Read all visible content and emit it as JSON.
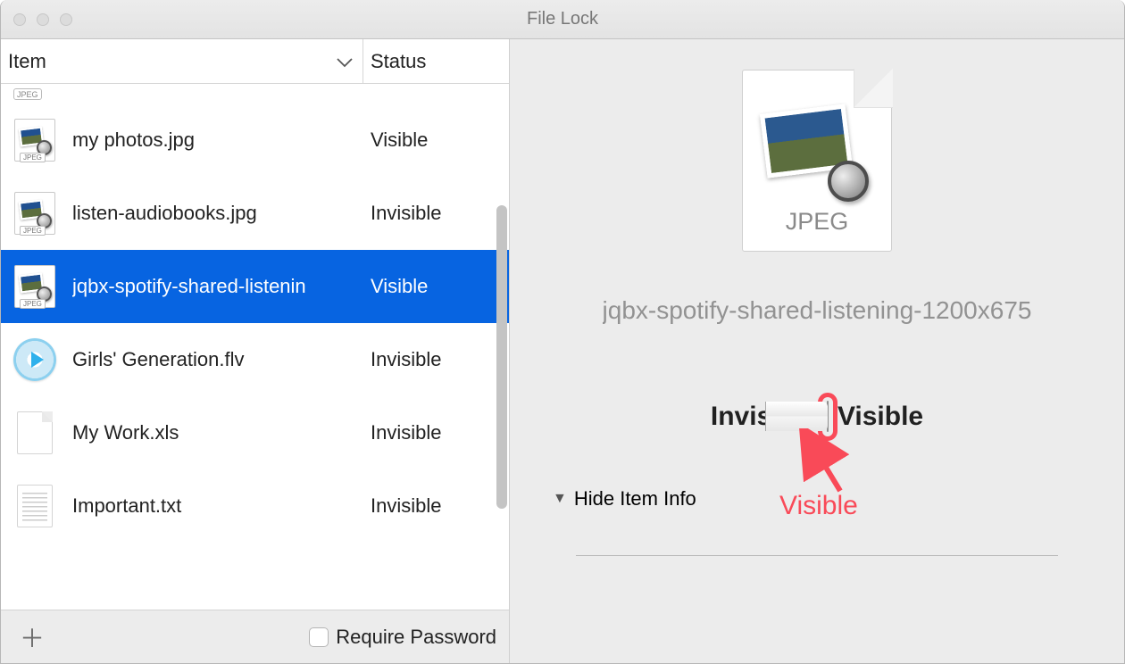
{
  "window": {
    "title": "File Lock"
  },
  "columns": {
    "item": "Item",
    "status": "Status"
  },
  "partialTopTag": "JPEG",
  "rows": [
    {
      "name": "my photos.jpg",
      "status": "Visible",
      "icon": "jpeg",
      "selected": false
    },
    {
      "name": "listen-audiobooks.jpg",
      "status": "Invisible",
      "icon": "jpeg",
      "selected": false
    },
    {
      "name": "jqbx-spotify-shared-listenin",
      "status": "Visible",
      "icon": "jpeg",
      "selected": true
    },
    {
      "name": "Girls' Generation.flv",
      "status": "Invisible",
      "icon": "flv",
      "selected": false
    },
    {
      "name": "My Work.xls",
      "status": "Invisible",
      "icon": "blank",
      "selected": false
    },
    {
      "name": "Important.txt",
      "status": "Invisible",
      "icon": "txt",
      "selected": false
    }
  ],
  "footer": {
    "requirePasswordLabel": "Require Password",
    "requirePasswordChecked": false
  },
  "preview": {
    "fileTypeLabel": "JPEG",
    "fileName": "jqbx-spotify-shared-listening-1200x675",
    "invisibleLabel": "Invisible",
    "visibleLabel": "Visible",
    "switchState": "visible",
    "hideInfoLabel": "Hide Item Info"
  },
  "annotation": {
    "calloutText": "Visible",
    "highlightColor": "#f94a58"
  }
}
